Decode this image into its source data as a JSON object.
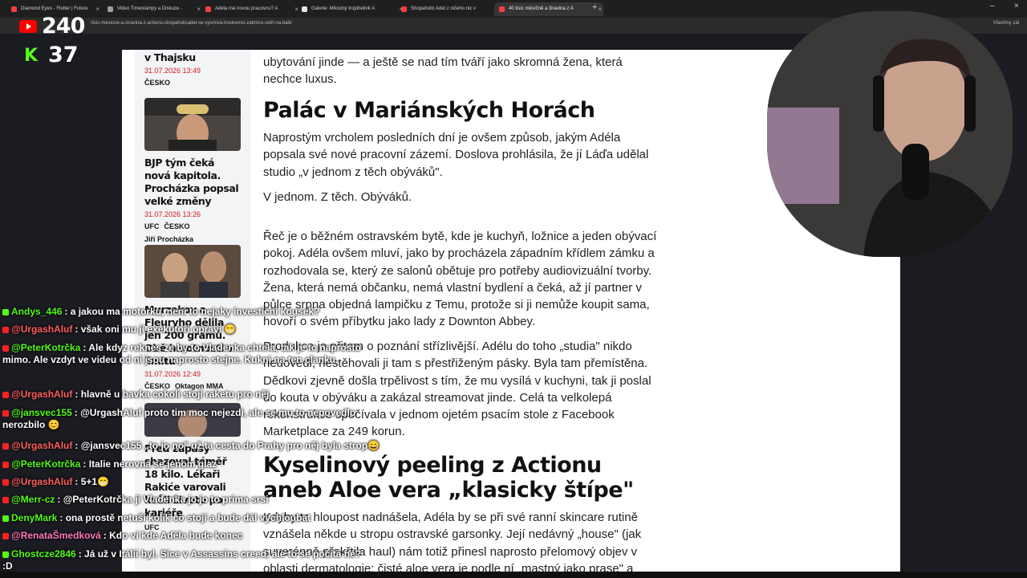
{
  "browser": {
    "tabs": [
      {
        "label": "Diamond Eyes - Flutter | Future",
        "color": "#ff3d3d"
      },
      {
        "label": "Video Timestampy a Diskuze -",
        "color": "#9aa0a6"
      },
      {
        "label": "Adéla má novou pracovnu? A",
        "color": "#ff3d3d"
      },
      {
        "label": "Galerie: Milostný trojúhelník A",
        "color": "#e6e6e6"
      },
      {
        "label": "Shopaholic Adel z ničeho nic v",
        "color": "#ff3d3d"
      },
      {
        "label": "40 tisíc měsíčně a žiravina z A",
        "color": "#ff3d3d"
      }
    ],
    "new_tab": "+",
    "url": "-tisic-mesicne-a-ziravina-z-actionu-shopaholicadel-se-vysmiva-insolvenci-zatimco-setri-na-italii/",
    "bookmarks_label": "Všechny zál"
  },
  "overlay": {
    "youtube_viewers": "240",
    "kick_viewers": "37",
    "kick_letter": "K"
  },
  "sidebar": {
    "cards": [
      {
        "title": "v Thajsku",
        "date": "31.07.2026 13:49",
        "tags": [
          "ČESKO"
        ]
      },
      {
        "title": "BJP tým čeká nová kapitola. Procházka popsal velké změny",
        "date": "31.07.2026 13:26",
        "tags": [
          "UFC",
          "ČESKO"
        ],
        "author": "Jiří Procházka"
      },
      {
        "title": "Murzakov a Fleuryho dělila jen 200 gramů. Obě hmotnosti v limitu",
        "date": "31.07.2026 12:49",
        "tags": [
          "ČESKO",
          "Oktagon MMA"
        ]
      },
      {
        "title": "Před zápasy shazoval téměř 18 kilo. Lékaři Rakiće varovali kvůli životu po kariéře",
        "tags": [
          "UFC"
        ]
      }
    ]
  },
  "article": {
    "intro_p": "ubytování jinde — a ještě se nad tím tváří jako skromná žena, která nechce luxus.",
    "h2_1": "Palác v Mariánských Horách",
    "p1": "Naprostým vrcholem posledních dní je ovšem způsob, jakým Adéla popsala své nové pracovní zázemí. Doslova prohlásila, že jí Láďa udělal studio „v jednom z těch obýváků\".",
    "p2": "V jednom. Z těch. Obýváků.",
    "p3": "Řeč je o běžném ostravském bytě, kde je kuchyň, ložnice a jeden obývací pokoj. Adéla ovšem mluví, jako by procházela západním křídlem zámku a rozhodovala se, který ze salonů obětuje pro potřeby audiovizuální tvorby. Žena, která nemá občanku, nemá vlastní bydlení a čeká, až jí partner v půlce srpna objedná lampičku z Temu, protože si ji nemůže koupit sama, hovoří o svém příbytku jako lady z Downton Abbey.",
    "p4": "Produkce je přitom o poznání střízlivější. Adélu do toho „studia\" nikdo nedovedl, nestěhovali ji tam s přestřiženým pásky. Byla tam přemístěna. Dědkovi zjevně došla trpělivost s tím, že mu vysílá v kuchyni, tak ji poslal do kouta v obýváku a zakázal streamovat jinde. Celá ta velkolepá rekonstrukce spočívala v jednom ojetém psacím stole z Facebook Marketplace za 249 korun.",
    "h2_2": "Kyselinový peeling z Actionu aneb Aloe vera „klasicky štípe\"",
    "p5": "Kdyby to hloupost nadnášela, Adéla by se při své ranní skincare rutině vznášela někde u stropu ostravské garsonky. Její nedávný „house\" (jak suverénně překřtila haul) nám totiž přinesl naprosto přelomový objev v oblasti dermatologie: čisté aloe vera je podle ní „mastný jako prase\" a"
  },
  "chat": [
    {
      "platform": "kick",
      "user": "Andys_446",
      "user_color": "#53fc18",
      "text": ": a jakou ma motorku, neni to nejaky investicni kousek?"
    },
    {
      "platform": "youtube",
      "user": "@UrgashAluf",
      "user_color": "#ff6060",
      "text": ": však oni mu jí exekutoři opraví 😁"
    },
    {
      "platform": "youtube",
      "user": "@PeterKotrčka",
      "user_color": "#53fc18",
      "text": ": Ale kdyz reknes ze by to Vladenka chtela, tak je to naprosto mimo. Ale vzdyt ve videu od ni jsou naprosto stejne. Kukni na ten clanku."
    },
    {
      "platform": "youtube",
      "user": "@UrgashAluf",
      "user_color": "#ff6060",
      "text": ": hlavně u bavka cokoli stojí raketu pro něj"
    },
    {
      "platform": "youtube",
      "user": "@jansvec155",
      "user_color": "#53fc18",
      "text": ": @UrgashAluf proto tim moc nejezdi, ale se mu to nepovedlo nerozbilo 😊"
    },
    {
      "platform": "youtube",
      "user": "@UrgashAluf",
      "user_color": "#ff6060",
      "text": ": @jansvec155 „to jo no\" už ta cesta do Prahy pro něj byla strop😄"
    },
    {
      "platform": "youtube",
      "user": "@PeterKotrčka",
      "user_color": "#53fc18",
      "text": ": Italie nerovna se jenom glaz"
    },
    {
      "platform": "youtube",
      "user": "@UrgashAluf",
      "user_color": "#ff6060",
      "text": ": 5+1😁"
    },
    {
      "platform": "youtube",
      "user": "@Merr-cz",
      "user_color": "#53fc18",
      "text": ": @PeterKotrčka ji Vladenka jo jo to prima srsi"
    },
    {
      "platform": "kick",
      "user": "DenyMark",
      "user_color": "#53fc18",
      "text": ": ona prostě netuší kolik co stojí a bude dál vychloubat"
    },
    {
      "platform": "youtube",
      "user": "@RenataŠmedková",
      "user_color": "#ff7ab8",
      "text": ": Kdo ví kde Adéla bude konec"
    },
    {
      "platform": "kick",
      "user": "Ghostcze2846",
      "user_color": "#53fc18",
      "text": ": Já už v Itálii byl. Sice v Assassins creed, ale to se počítá ne? :D"
    }
  ]
}
